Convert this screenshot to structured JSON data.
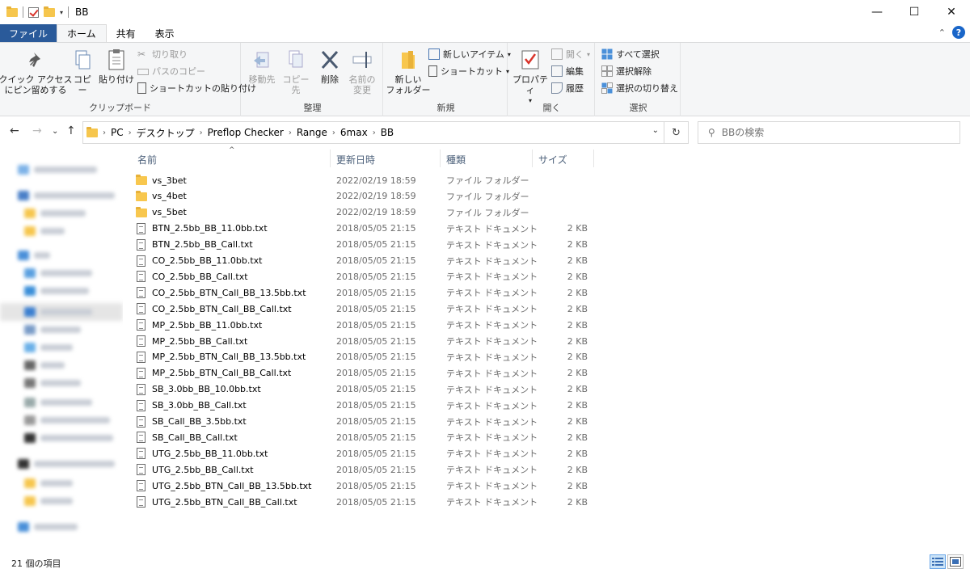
{
  "window": {
    "title": "BB",
    "controls": {
      "minimize": "—",
      "maximize": "☐",
      "close": "✕"
    }
  },
  "tabs": [
    {
      "label": "ファイル"
    },
    {
      "label": "ホーム"
    },
    {
      "label": "共有"
    },
    {
      "label": "表示"
    }
  ],
  "ribbon": {
    "clipboard": {
      "label": "クリップボード",
      "pin": "クイック アクセス\nにピン留めする",
      "copy": "コピー",
      "paste": "貼り付け",
      "cut": "切り取り",
      "copy_path": "パスのコピー",
      "paste_shortcut": "ショートカットの貼り付け"
    },
    "organize": {
      "label": "整理",
      "move_to": "移動先",
      "copy_to": "コピー先",
      "delete": "削除",
      "rename": "名前の\n変更"
    },
    "new": {
      "label": "新規",
      "new_folder": "新しい\nフォルダー",
      "new_item": "新しいアイテム",
      "shortcut": "ショートカット"
    },
    "open": {
      "label": "開く",
      "properties": "プロパティ",
      "open": "開く",
      "edit": "編集",
      "history": "履歴"
    },
    "select": {
      "label": "選択",
      "select_all": "すべて選択",
      "select_none": "選択解除",
      "invert": "選択の切り替え"
    }
  },
  "address": {
    "crumbs": [
      "PC",
      "デスクトップ",
      "Preflop Checker",
      "Range",
      "6max",
      "BB"
    ],
    "search_placeholder": "BBの検索"
  },
  "columns": {
    "name": "名前",
    "date": "更新日時",
    "type": "種類",
    "size": "サイズ"
  },
  "files": [
    {
      "name": "vs_3bet",
      "date": "2022/02/19 18:59",
      "type": "ファイル フォルダー",
      "size": "",
      "kind": "folder"
    },
    {
      "name": "vs_4bet",
      "date": "2022/02/19 18:59",
      "type": "ファイル フォルダー",
      "size": "",
      "kind": "folder"
    },
    {
      "name": "vs_5bet",
      "date": "2022/02/19 18:59",
      "type": "ファイル フォルダー",
      "size": "",
      "kind": "folder"
    },
    {
      "name": "BTN_2.5bb_BB_11.0bb.txt",
      "date": "2018/05/05 21:15",
      "type": "テキスト ドキュメント",
      "size": "2 KB",
      "kind": "txt"
    },
    {
      "name": "BTN_2.5bb_BB_Call.txt",
      "date": "2018/05/05 21:15",
      "type": "テキスト ドキュメント",
      "size": "2 KB",
      "kind": "txt"
    },
    {
      "name": "CO_2.5bb_BB_11.0bb.txt",
      "date": "2018/05/05 21:15",
      "type": "テキスト ドキュメント",
      "size": "2 KB",
      "kind": "txt"
    },
    {
      "name": "CO_2.5bb_BB_Call.txt",
      "date": "2018/05/05 21:15",
      "type": "テキスト ドキュメント",
      "size": "2 KB",
      "kind": "txt"
    },
    {
      "name": "CO_2.5bb_BTN_Call_BB_13.5bb.txt",
      "date": "2018/05/05 21:15",
      "type": "テキスト ドキュメント",
      "size": "2 KB",
      "kind": "txt"
    },
    {
      "name": "CO_2.5bb_BTN_Call_BB_Call.txt",
      "date": "2018/05/05 21:15",
      "type": "テキスト ドキュメント",
      "size": "2 KB",
      "kind": "txt"
    },
    {
      "name": "MP_2.5bb_BB_11.0bb.txt",
      "date": "2018/05/05 21:15",
      "type": "テキスト ドキュメント",
      "size": "2 KB",
      "kind": "txt"
    },
    {
      "name": "MP_2.5bb_BB_Call.txt",
      "date": "2018/05/05 21:15",
      "type": "テキスト ドキュメント",
      "size": "2 KB",
      "kind": "txt"
    },
    {
      "name": "MP_2.5bb_BTN_Call_BB_13.5bb.txt",
      "date": "2018/05/05 21:15",
      "type": "テキスト ドキュメント",
      "size": "2 KB",
      "kind": "txt"
    },
    {
      "name": "MP_2.5bb_BTN_Call_BB_Call.txt",
      "date": "2018/05/05 21:15",
      "type": "テキスト ドキュメント",
      "size": "2 KB",
      "kind": "txt"
    },
    {
      "name": "SB_3.0bb_BB_10.0bb.txt",
      "date": "2018/05/05 21:15",
      "type": "テキスト ドキュメント",
      "size": "2 KB",
      "kind": "txt"
    },
    {
      "name": "SB_3.0bb_BB_Call.txt",
      "date": "2018/05/05 21:15",
      "type": "テキスト ドキュメント",
      "size": "2 KB",
      "kind": "txt"
    },
    {
      "name": "SB_Call_BB_3.5bb.txt",
      "date": "2018/05/05 21:15",
      "type": "テキスト ドキュメント",
      "size": "2 KB",
      "kind": "txt"
    },
    {
      "name": "SB_Call_BB_Call.txt",
      "date": "2018/05/05 21:15",
      "type": "テキスト ドキュメント",
      "size": "2 KB",
      "kind": "txt"
    },
    {
      "name": "UTG_2.5bb_BB_11.0bb.txt",
      "date": "2018/05/05 21:15",
      "type": "テキスト ドキュメント",
      "size": "2 KB",
      "kind": "txt"
    },
    {
      "name": "UTG_2.5bb_BB_Call.txt",
      "date": "2018/05/05 21:15",
      "type": "テキスト ドキュメント",
      "size": "2 KB",
      "kind": "txt"
    },
    {
      "name": "UTG_2.5bb_BTN_Call_BB_13.5bb.txt",
      "date": "2018/05/05 21:15",
      "type": "テキスト ドキュメント",
      "size": "2 KB",
      "kind": "txt"
    },
    {
      "name": "UTG_2.5bb_BTN_Call_BB_Call.txt",
      "date": "2018/05/05 21:15",
      "type": "テキスト ドキュメント",
      "size": "2 KB",
      "kind": "txt"
    }
  ],
  "status": {
    "item_count": "21 個の項目"
  },
  "colors": {
    "accent": "#1e6fc4",
    "folder": "#f8c74e",
    "header_text": "#4c607a"
  }
}
